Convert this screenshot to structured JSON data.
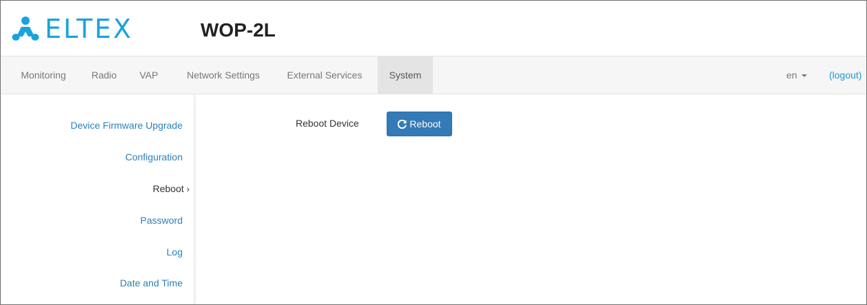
{
  "header": {
    "brand": "ELTEX",
    "model": "WOP-2L"
  },
  "nav": {
    "items": [
      "Monitoring",
      "Radio",
      "VAP",
      "Network Settings",
      "External Services",
      "System"
    ],
    "active": "System",
    "language": "en",
    "logout": "(logout)"
  },
  "sidebar": {
    "items": [
      {
        "label": "Device Firmware Upgrade"
      },
      {
        "label": "Configuration"
      },
      {
        "label": "Reboot",
        "active": true
      },
      {
        "label": "Password"
      },
      {
        "label": "Log"
      },
      {
        "label": "Date and Time"
      }
    ],
    "active_marker": "›"
  },
  "main": {
    "field_label": "Reboot Device",
    "reboot_button": "Reboot",
    "reboot_icon": "refresh-icon"
  },
  "colors": {
    "brand": "#1aa2de",
    "link": "#2a80b9",
    "button": "#337ab7",
    "active_tab": "#e4e4e4",
    "navbar": "#f6f6f6"
  }
}
